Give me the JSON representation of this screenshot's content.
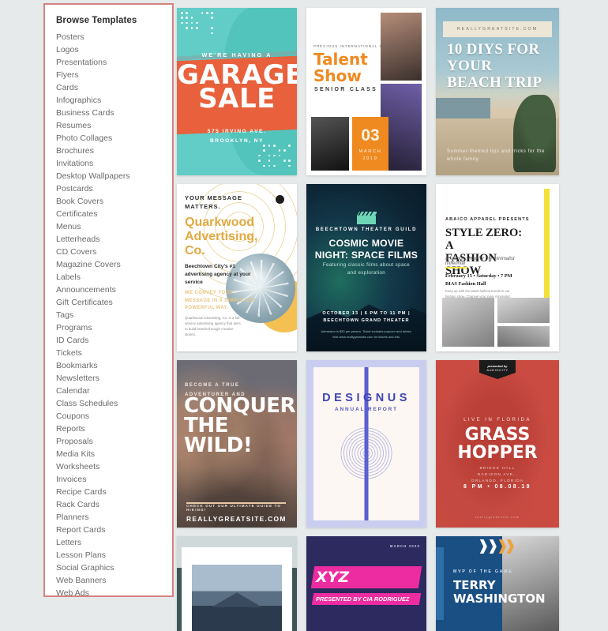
{
  "sidebar": {
    "heading": "Browse Templates",
    "items": [
      "Posters",
      "Logos",
      "Presentations",
      "Flyers",
      "Cards",
      "Infographics",
      "Business Cards",
      "Resumes",
      "Photo Collages",
      "Brochures",
      "Invitations",
      "Desktop Wallpapers",
      "Postcards",
      "Book Covers",
      "Certificates",
      "Menus",
      "Letterheads",
      "CD Covers",
      "Magazine Covers",
      "Labels",
      "Announcements",
      "Gift Certificates",
      "Tags",
      "Programs",
      "ID Cards",
      "Tickets",
      "Bookmarks",
      "Newsletters",
      "Calendar",
      "Class Schedules",
      "Coupons",
      "Reports",
      "Proposals",
      "Media Kits",
      "Worksheets",
      "Invoices",
      "Recipe Cards",
      "Rack Cards",
      "Planners",
      "Report Cards",
      "Letters",
      "Lesson Plans",
      "Social Graphics",
      "Web Banners",
      "Web Ads"
    ]
  },
  "colors": {
    "page_background": "#e7eaeb",
    "sidebar_border": "#d4827f",
    "garage_teal": "#62ccc6",
    "garage_orange": "#e8603c",
    "talent_orange": "#ef8a21",
    "quark_gold": "#e2a940",
    "cosmic_teal": "#1f6d5e",
    "style_yellow": "#f5e03c",
    "designus_blue": "#5b5fd1",
    "grass_red": "#c94b42",
    "xyz_pink": "#ec2ca0",
    "xyz_navy": "#2c2a5e",
    "mvp_blue": "#1a4f84"
  },
  "templates": [
    {
      "name": "garage-sale-poster",
      "eyebrow": "WE'RE HAVING A",
      "title_line1": "GARAGE",
      "title_line2": "SALE",
      "address_line1": "575 IRVING AVE.",
      "address_line2": "BROOKLYN, NY"
    },
    {
      "name": "talent-show-poster",
      "school": "PRECIOUS INTERNATIONAL SCHOOL",
      "title_line1": "Talent",
      "title_line2": "Show",
      "subtitle": "SENIOR CLASS",
      "day": "03",
      "month": "MARCH",
      "year": "2019"
    },
    {
      "name": "beach-trip-poster",
      "site": "REALLYGREATSITE.COM",
      "headline": "10 DIYS FOR YOUR BEACH TRIP",
      "footer": "Summer-themed tips and tricks for the whole family."
    },
    {
      "name": "quarkwood-advertising-poster",
      "eyebrow": "YOUR MESSAGE MATTERS.",
      "company": "Quarkwood Advertising, Co.",
      "tagline": "Beechtown City's #1 advertising agency at your service",
      "highlight": "WE CONVEY YOUR MESSAGE IN A SIMPLE YET POWERFUL WAY.",
      "body": "Quarkwood Advertising, Co. is a full-service advertising agency that aims to build brands through creative stories."
    },
    {
      "name": "cosmic-movie-night-poster",
      "guild": "BEECHTOWN THEATER GUILD",
      "title_line1": "COSMIC MOVIE",
      "title_line2": "NIGHT: SPACE FILMS",
      "subtitle": "Featuring classic films about space and exploration",
      "when_line1": "OCTOBER 13 | 6 PM TO 11 PM |",
      "when_line2": "BEECHTOWN GRAND THEATER",
      "fine_print": "Admission is $30 per person. Ticket includes popcorn and drinks. Visit www.reallygreatsite.com for tickets and info."
    },
    {
      "name": "style-zero-fashion-show-poster",
      "presenter": "ABAICO APPAREL PRESENTS",
      "title_line1": "STYLE ZERO: A",
      "title_line2": "FASHION SHOW",
      "tagline": "A fashion show for the minimalist millennial",
      "date": "February 15 • Saturday • 7 PM",
      "venue": "BIAS Fashion Hall",
      "body": "Keep up with the latest fashion trends in our fashion show. Channel your inner minimalist with our exquisite collection."
    },
    {
      "name": "conquer-the-wild-poster",
      "eyebrow_line1": "BECOME A TRUE",
      "eyebrow_line2": "ADVENTURER AND",
      "title_line1": "CONQUER",
      "title_line2": "THE",
      "title_line3": "WILD!",
      "cta": "CHECK OUT OUR ULTIMATE GUIDE TO HIKING!",
      "site": "REALLYGREATSITE.COM"
    },
    {
      "name": "designus-annual-report",
      "title": "DESIGNUS",
      "subtitle": "ANNUAL REPORT"
    },
    {
      "name": "grass-hopper-concert-poster",
      "tag_line1": "presented by",
      "tag_line2": "AUDIOCITY",
      "eyebrow": "LIVE IN FLORIDA",
      "title_line1": "GRASS",
      "title_line2": "HOPPER",
      "venue_line1": "BRIDGE HALL",
      "venue_line2": "RADISON AVE.,",
      "venue_line3": "ORLANDO, FLORIDA",
      "time": "8 PM • 08.08.19",
      "site": "reallygreatsite.com"
    },
    {
      "name": "real-estate-house-template"
    },
    {
      "name": "xyz-network-presentation",
      "date": "MARCH 2020",
      "title": "XYZ NETWORK",
      "presenter": "PRESENTED BY CIA RODRIGUEZ"
    },
    {
      "name": "mvp-of-the-game-banner",
      "eyebrow": "MVP OF THE GAME",
      "name_line1": "TERRY",
      "name_line2": "WASHINGTON"
    }
  ]
}
